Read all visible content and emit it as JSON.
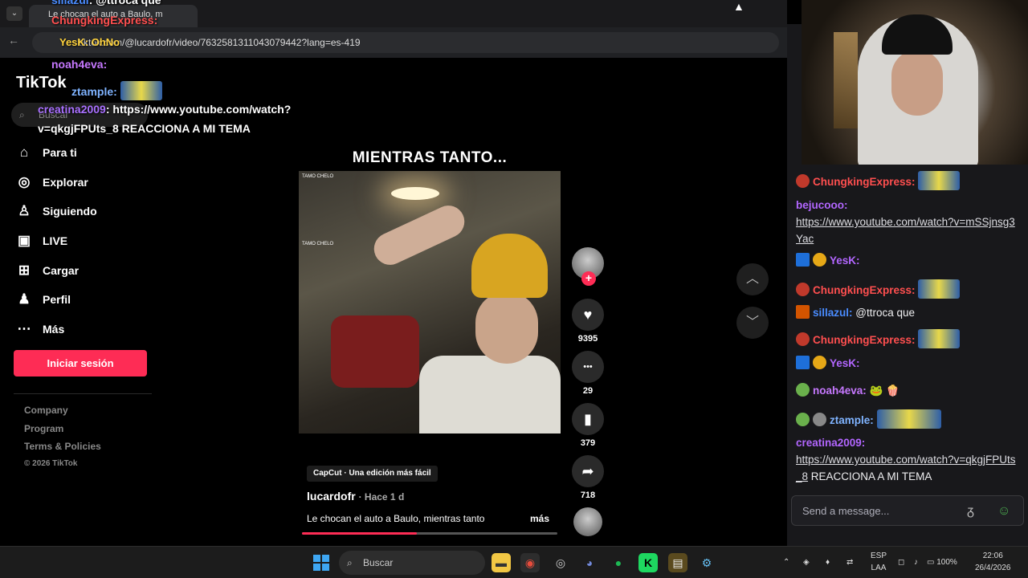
{
  "browser": {
    "tab_title": "Le chocan el auto a Baulo, m",
    "url": "tiktok.com/@lucardofr/video/7632581311043079442?lang=es-419"
  },
  "tiktok": {
    "logo": "TikTok",
    "search_placeholder": "Buscar",
    "nav": [
      {
        "icon": "home-icon",
        "label": "Para ti",
        "glyph": "⌂"
      },
      {
        "icon": "compass-icon",
        "label": "Explorar",
        "glyph": "◎"
      },
      {
        "icon": "following-icon",
        "label": "Siguiendo",
        "glyph": "♙"
      },
      {
        "icon": "live-icon",
        "label": "LIVE",
        "glyph": "▣"
      },
      {
        "icon": "upload-icon",
        "label": "Cargar",
        "glyph": "⊞"
      },
      {
        "icon": "profile-icon",
        "label": "Perfil",
        "glyph": "♟"
      },
      {
        "icon": "more-icon",
        "label": "Más",
        "glyph": "⋯"
      }
    ],
    "login_label": "Iniciar sesión",
    "footer": [
      "Company",
      "Program",
      "Terms & Policies"
    ],
    "copyright": "© 2026 TikTok",
    "video_caption_title": "MIENTRAS TANTO...",
    "video_overlay_text": "TAMO CHELO",
    "capcut_label": "CapCut · Una edición más fácil",
    "author": "lucardofr",
    "time_ago": "· Hace 1 d",
    "description": "Le chocan el auto a Baulo, mientras tanto",
    "more_label": "más",
    "progress_fraction": 0.45,
    "actions": [
      {
        "name": "like",
        "glyph": "♥",
        "count": "9395"
      },
      {
        "name": "comment",
        "glyph": "•••",
        "count": "29"
      },
      {
        "name": "bookmark",
        "glyph": "▮",
        "count": "379"
      },
      {
        "name": "share",
        "glyph": "➦",
        "count": "718"
      }
    ]
  },
  "overlay_chat": [
    {
      "user": "sillazul",
      "text": ": @ttroca que",
      "color": "#4a8cff"
    },
    {
      "user": "ChungkingExpress:",
      "text": "",
      "color": "#ff4f4f"
    },
    {
      "user": "YesK: OhNo",
      "text": "",
      "color": "#ffd33d"
    },
    {
      "user": "noah4eva:",
      "text": "",
      "color": "#c678ff"
    },
    {
      "user": "ztample:",
      "text": "",
      "color": "#7fb3ff"
    },
    {
      "user": "creatina2009",
      "text": ": https://www.youtube.com/watch?",
      "color": "#a970ff"
    },
    {
      "user": "",
      "text": "v=qkgjFPUts_8 REACCIONA A MI TEMA",
      "color": "#fff"
    }
  ],
  "chat": [
    {
      "user": "ChungkingExpress:",
      "color": "#ff4f4f",
      "text": "",
      "emote": true,
      "badge": "#c0392b"
    },
    {
      "user": "bejucooo:",
      "color": "#b266ff",
      "text": "",
      "link": "https://www.youtube.com/watch?v=mSSjnsg3Yac"
    },
    {
      "user": "YesK:",
      "color": "#b266ff",
      "text": "",
      "emote": false,
      "badge": "#1e6fd9"
    },
    {
      "user": "ChungkingExpress:",
      "color": "#ff4f4f",
      "text": "",
      "emote": true,
      "badge": "#c0392b"
    },
    {
      "user": "sillazul:",
      "color": "#4a8cff",
      "text": "@ttroca que",
      "badge": "#d35400"
    },
    {
      "user": "ChungkingExpress:",
      "color": "#ff4f4f",
      "text": "",
      "emote": true,
      "badge": "#c0392b"
    },
    {
      "user": "YesK:",
      "color": "#b266ff",
      "text": "",
      "badge": "#1e6fd9"
    },
    {
      "user": "noah4eva:",
      "color": "#c678ff",
      "text": "",
      "badge": "#6ab04c"
    },
    {
      "user": "ztample:",
      "color": "#7fb3ff",
      "text": "",
      "emote": true,
      "badge": "#6ab04c"
    },
    {
      "user": "creatina2009:",
      "color": "#b266ff",
      "text": "REACCIONA A MI TEMA",
      "link": "https://www.youtube.com/watch?v=qkgjFPUts_8"
    }
  ],
  "chat_input_placeholder": "Send a message...",
  "taskbar": {
    "search_label": "Buscar",
    "lang": "ESP",
    "layout": "LAA",
    "battery": "100%",
    "time": "22:06",
    "date": "26/4/2026"
  }
}
